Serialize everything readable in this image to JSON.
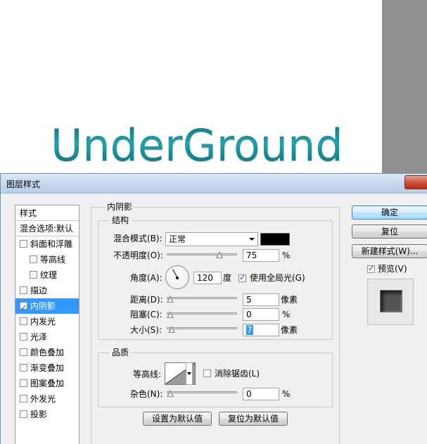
{
  "canvas": {
    "text": "UnderGround"
  },
  "dialog": {
    "title": "图层样式",
    "style_list": {
      "header": "样式",
      "blend_options": "混合选项:默认",
      "items": [
        {
          "label": "斜面和浮雕",
          "checked": false,
          "indent": false
        },
        {
          "label": "等高线",
          "checked": false,
          "indent": true
        },
        {
          "label": "纹理",
          "checked": false,
          "indent": true
        },
        {
          "label": "描边",
          "checked": false,
          "indent": false
        },
        {
          "label": "内阴影",
          "checked": true,
          "indent": false,
          "selected": true
        },
        {
          "label": "内发光",
          "checked": false,
          "indent": false
        },
        {
          "label": "光泽",
          "checked": false,
          "indent": false
        },
        {
          "label": "颜色叠加",
          "checked": false,
          "indent": false
        },
        {
          "label": "渐变叠加",
          "checked": false,
          "indent": false
        },
        {
          "label": "图案叠加",
          "checked": false,
          "indent": false
        },
        {
          "label": "外发光",
          "checked": false,
          "indent": false
        },
        {
          "label": "投影",
          "checked": false,
          "indent": false
        }
      ]
    },
    "inner_shadow": {
      "title": "内阴影",
      "structure": {
        "title": "结构",
        "blend_mode_label": "混合模式(B):",
        "blend_mode_value": "正常",
        "color": "#000000",
        "opacity_label": "不透明度(O):",
        "opacity_value": "75",
        "opacity_unit": "%",
        "opacity_fraction": 0.75,
        "angle_label": "角度(A):",
        "angle_value": "120",
        "angle_unit": "度",
        "global_light_label": "使用全局光(G)",
        "global_light_checked": true,
        "distance_label": "距离(D):",
        "distance_value": "5",
        "distance_unit": "像素",
        "choke_label": "阻塞(C):",
        "choke_value": "0",
        "choke_unit": "%",
        "size_label": "大小(S):",
        "size_value": "7",
        "size_unit": "像素"
      },
      "quality": {
        "title": "品质",
        "contour_label": "等高线:",
        "antialias_label": "消除锯齿(L)",
        "antialias_checked": false,
        "noise_label": "杂色(N):",
        "noise_value": "0",
        "noise_unit": "%"
      },
      "set_default_label": "设置为默认值",
      "reset_default_label": "复位为默认值"
    },
    "buttons": {
      "ok": "确定",
      "reset": "复位",
      "new_style": "新建样式(W)...",
      "preview_label": "预览(V)",
      "preview_checked": true
    }
  }
}
